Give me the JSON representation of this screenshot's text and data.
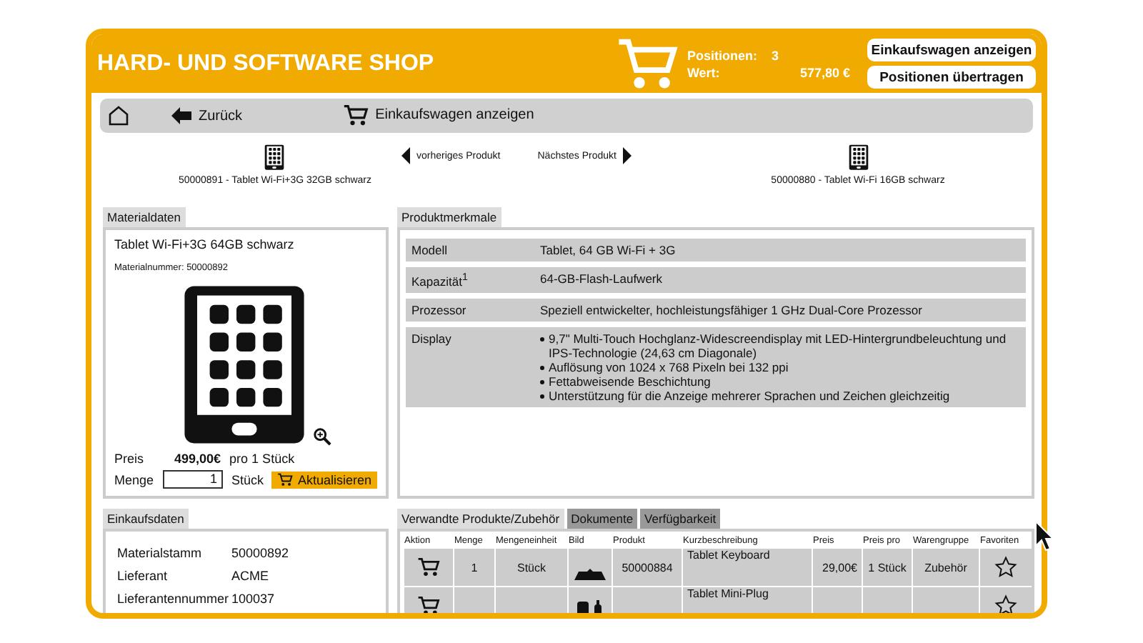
{
  "header": {
    "title": "HARD- UND SOFTWARE SHOP",
    "positions_label": "Positionen:",
    "positions_value": "3",
    "value_label": "Wert:",
    "value": "577,80 €",
    "buttons": [
      "Einkaufswagen anzeigen",
      "Positionen übertragen"
    ]
  },
  "toolbar": [
    {
      "kind": "home"
    },
    {
      "kind": "back",
      "label": "Zurück"
    },
    {
      "kind": "cart",
      "label": "Einkaufswagen anzeigen"
    }
  ],
  "product_nav": {
    "previous_product": "50000891 - Tablet Wi-Fi+3G 32GB schwarz",
    "previous_link": "vorheriges Produkt",
    "next_link": "Nächstes Produkt",
    "next_product": "50000880 - Tablet Wi-Fi 16GB schwarz"
  },
  "material": {
    "tab": "Materialdaten",
    "name": "Tablet Wi-Fi+3G 64GB schwarz",
    "number": "Materialnummer: 50000892",
    "price_label": "Preis",
    "price": "499,00€",
    "per": "pro 1 Stück",
    "quantity_label": "Menge",
    "quantity": "1",
    "unit": "Stück",
    "update_button": "Aktualisieren"
  },
  "features": {
    "tab": "Produktmerkmale",
    "rows": [
      {
        "label": "Modell",
        "value": "Tablet, 64 GB Wi-Fi + 3G"
      },
      {
        "label": "Kapazität$^{1}$",
        "value": "64-GB-Flash-Laufwerk"
      },
      {
        "label": "Prozessor",
        "value": "Speziell entwickelter, hochleistungsfähiger 1 GHz Dual-Core Prozessor"
      },
      {
        "label": "Display",
        "bullets": [
          "9,7\" Multi-Touch Hochglanz-Widescreendisplay mit LED-Hintergrundbeleuchtung und IPS-Technologie (24,63 cm Diagonale)",
          "Auflösung von 1024 x 768 Pixeln bei 132 ppi",
          "Fettabweisende Beschichtung",
          "Unterstützung für die Anzeige mehrerer Sprachen und Zeichen gleichzeitig"
        ]
      }
    ]
  },
  "purchase": {
    "tab": "Einkaufsdaten",
    "rows": [
      {
        "label": "Materialstamm",
        "value": "50000892"
      },
      {
        "label": "Lieferant",
        "value": "ACME"
      },
      {
        "label": "Lieferantennummer",
        "value": "100037"
      }
    ]
  },
  "related": {
    "tabs": [
      {
        "label": "Verwandte Produkte/Zubehör",
        "selected": true
      },
      {
        "label": "Dokumente",
        "selected": false
      },
      {
        "label": "Verfügbarkeit",
        "selected": false
      }
    ],
    "columns": [
      "Aktion",
      "Menge",
      "Mengeneinheit",
      "Bild",
      "Produkt",
      "Kurzbeschreibung",
      "Preis",
      "Preis pro",
      "Warengruppe",
      "Favoriten"
    ],
    "rows": [
      {
        "quantity": "1",
        "unit": "Stück",
        "kind": "keyboard",
        "product": "50000884",
        "description": "Tablet Keyboard",
        "price": "29,00€",
        "per": "1 Stück",
        "group": "Zubehör",
        "favorite": false
      },
      {
        "kind": "adapter",
        "description": "Tablet Mini-Plug",
        "favorite": false
      }
    ]
  }
}
